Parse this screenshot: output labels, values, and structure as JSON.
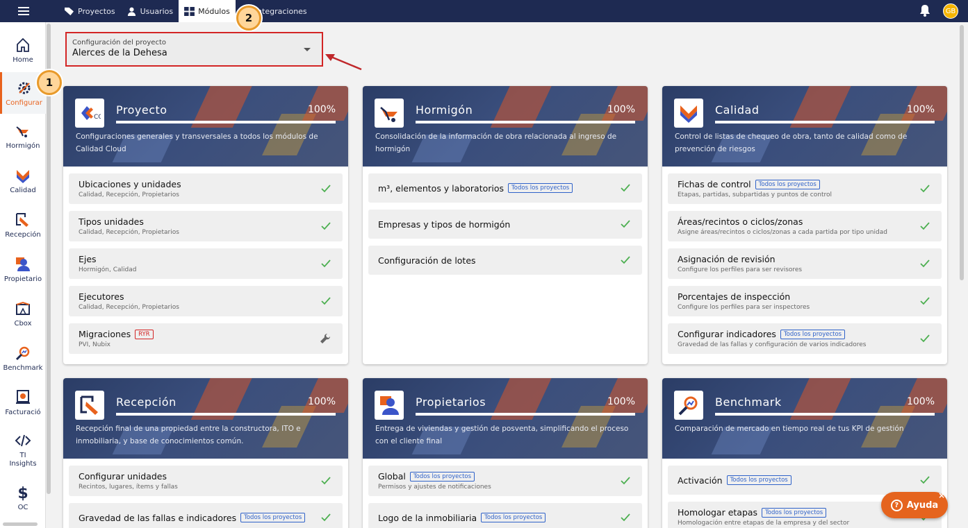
{
  "topbar": {
    "tabs": [
      {
        "label": "Proyectos",
        "icon": "tag-icon"
      },
      {
        "label": "Usuarios",
        "icon": "user-icon"
      },
      {
        "label": "Módulos",
        "icon": "grid-icon"
      },
      {
        "label": "Integraciones",
        "icon": "plug-icon"
      }
    ],
    "active_tab": "Módulos",
    "avatar_initials": "GB"
  },
  "sidebar": {
    "items": [
      {
        "label": "Home",
        "icon": "home-icon"
      },
      {
        "label": "Configurar",
        "icon": "gear-icon"
      },
      {
        "label": "Hormigón",
        "icon": "wheelbarrow-icon"
      },
      {
        "label": "Calidad",
        "icon": "quality-check-icon"
      },
      {
        "label": "Recepción",
        "icon": "reception-icon"
      },
      {
        "label": "Propietario",
        "icon": "owner-icon"
      },
      {
        "label": "Cbox",
        "icon": "cbox-icon"
      },
      {
        "label": "Benchmark",
        "icon": "magnifier-chart-icon"
      },
      {
        "label": "Facturació",
        "icon": "invoice-icon"
      },
      {
        "label": "TI Insights",
        "icon": "code-icon"
      },
      {
        "label": "OC",
        "icon": "dollar-icon"
      }
    ],
    "active_item": "Configurar"
  },
  "annotations": {
    "marker_1": "1",
    "marker_2": "2"
  },
  "project_selector": {
    "label": "Configuración del proyecto",
    "value": "Alerces de la Dehesa"
  },
  "cards": [
    {
      "title": "Proyecto",
      "percent": "100%",
      "description": "Configuraciones generales y transversales a todos los módulos de Calidad Cloud",
      "rows": [
        {
          "title": "Ubicaciones y unidades",
          "subtitle": "Calidad, Recepción, Propietarios",
          "status": "check"
        },
        {
          "title": "Tipos unidades",
          "subtitle": "Calidad, Recepción, Propietarios",
          "status": "check"
        },
        {
          "title": "Ejes",
          "subtitle": "Hormigón, Calidad",
          "status": "check"
        },
        {
          "title": "Ejecutores",
          "subtitle": "Calidad, Recepción, Propietarios",
          "status": "check"
        },
        {
          "title": "Migraciones",
          "tag": "RYR",
          "subtitle": "PVI, Nubix",
          "status": "wrench"
        }
      ]
    },
    {
      "title": "Hormigón",
      "percent": "100%",
      "description": "Consolidación de la información de obra relacionada al ingreso de hormigón",
      "rows": [
        {
          "title": "m³, elementos y laboratorios",
          "tag": "Todos los proyectos",
          "status": "check"
        },
        {
          "title": "Empresas y tipos de hormigón",
          "status": "check"
        },
        {
          "title": "Configuración de lotes",
          "status": "check"
        }
      ]
    },
    {
      "title": "Calidad",
      "percent": "100%",
      "description": "Control de listas de chequeo de obra, tanto de calidad como de prevención de riesgos",
      "rows": [
        {
          "title": "Fichas de control",
          "tag": "Todos los proyectos",
          "subtitle": "Etapas, partidas, subpartidas y puntos de control",
          "status": "check"
        },
        {
          "title": "Áreas/recintos o ciclos/zonas",
          "subtitle": "Asigne áreas/recintos o ciclos/zonas a cada partida por tipo unidad",
          "status": "check"
        },
        {
          "title": "Asignación de revisión",
          "subtitle": "Configure los perfiles para ser revisores",
          "status": "check"
        },
        {
          "title": "Porcentajes de inspección",
          "subtitle": "Configure los perfiles para ser inspectores",
          "status": "check"
        },
        {
          "title": "Configurar indicadores",
          "tag": "Todos los proyectos",
          "subtitle": "Gravedad de las fallas y configuración de varios indicadores",
          "status": "check"
        }
      ]
    },
    {
      "title": "Recepción",
      "percent": "100%",
      "description": "Recepción final de una propiedad entre la constructora, ITO e inmobiliaria, y base de conocimientos común.",
      "rows": [
        {
          "title": "Configurar unidades",
          "subtitle": "Recintos, lugares, ítems y fallas",
          "status": "check"
        },
        {
          "title": "Gravedad de las fallas e indicadores",
          "tag": "Todos los proyectos",
          "status": "check"
        }
      ]
    },
    {
      "title": "Propietarios",
      "percent": "100%",
      "description": "Entrega de viviendas y gestión de posventa, simplificando el proceso con el cliente final",
      "rows": [
        {
          "title": "Global",
          "tag": "Todos los proyectos",
          "subtitle": "Permisos y ajustes de notificaciones",
          "status": "check"
        },
        {
          "title": "Logo de la inmobiliaria",
          "tag": "Todos los proyectos",
          "status": "check"
        }
      ]
    },
    {
      "title": "Benchmark",
      "percent": "100%",
      "description": "Comparación de mercado en tiempo real de tus KPI de gestión",
      "rows": [
        {
          "title": "Activación",
          "tag": "Todos los proyectos",
          "status": "check"
        },
        {
          "title": "Homologar etapas",
          "tag": "Todos los proyectos",
          "subtitle": "Homologación entre etapas de la empresa y del sector",
          "status": "check"
        }
      ]
    }
  ],
  "help_button": {
    "label": "Ayuda",
    "close": "×"
  },
  "colors": {
    "navy": "#1e2a52",
    "accent": "#e8621d",
    "check": "#4caf50",
    "highlight": "#d32525"
  }
}
